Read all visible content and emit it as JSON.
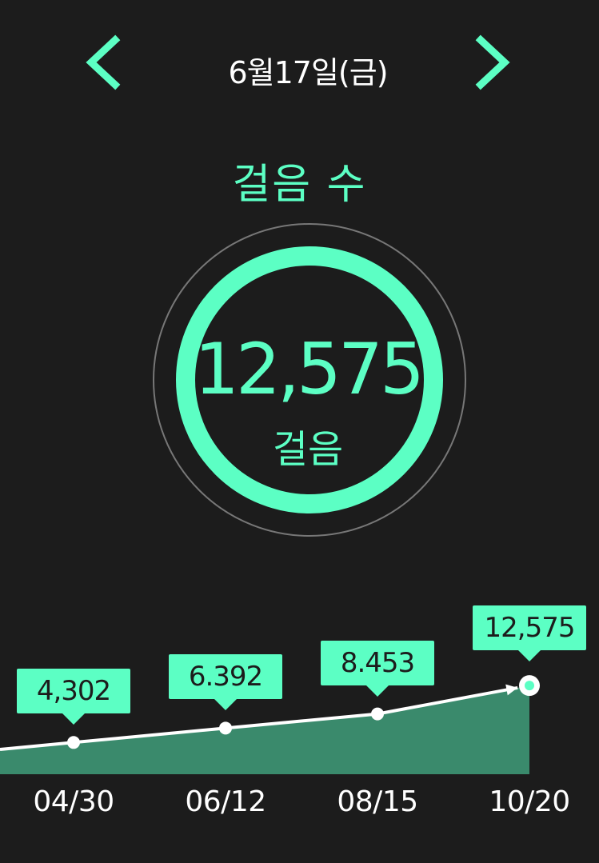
{
  "header": {
    "date": "6월17일(금)",
    "prev_icon": "chevron-left-icon",
    "next_icon": "chevron-right-icon"
  },
  "metric": {
    "title": "걸음 수",
    "value": "12,575",
    "unit": "걸음"
  },
  "colors": {
    "background": "#1c1c1c",
    "accent": "#5cffc4",
    "area_fill": "#3a8a6c",
    "ring_outline": "#777777",
    "line": "#ffffff"
  },
  "chart_data": {
    "type": "area",
    "categories": [
      "04/30",
      "06/12",
      "08/15",
      "10/20"
    ],
    "labels": [
      "4,302",
      "6.392",
      "8.453",
      "12,575"
    ],
    "values": [
      4302,
      6392,
      8453,
      12575
    ],
    "highlighted_index": 3
  }
}
